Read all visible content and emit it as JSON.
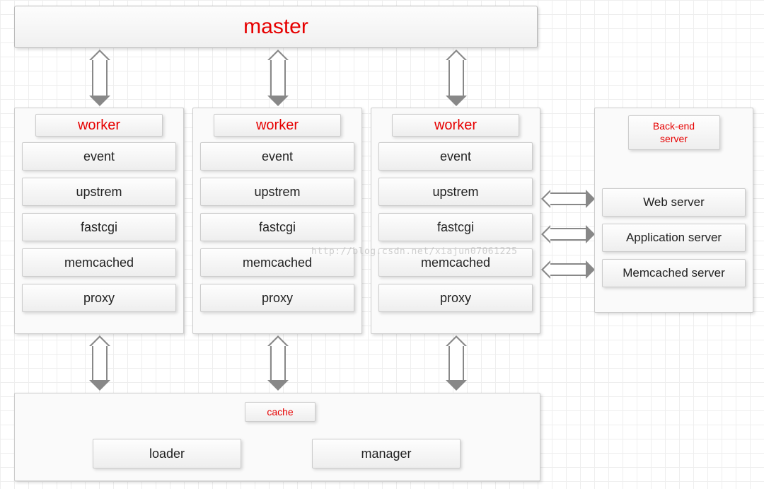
{
  "master": {
    "label": "master"
  },
  "workers": {
    "title": "worker",
    "modules": [
      "event",
      "upstrem",
      "fastcgi",
      "memcached",
      "proxy"
    ]
  },
  "backend": {
    "title_line1": "Back-end",
    "title_line2": "server",
    "items": [
      "Web server",
      "Application server",
      "Memcached server"
    ]
  },
  "cache": {
    "title": "cache",
    "items": [
      "loader",
      "manager"
    ]
  },
  "watermark": "http://blog.csdn.net/xiajun07061225"
}
